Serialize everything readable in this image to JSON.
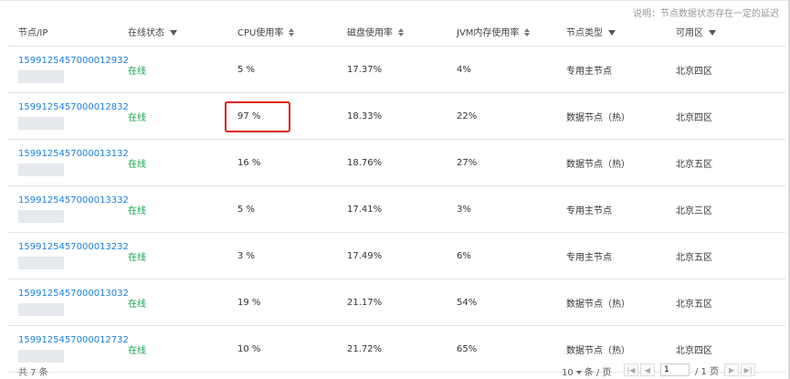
{
  "note": "说明：节点数据状态存在一定的延迟",
  "columns": {
    "node": "节点/IP",
    "status": "在线状态",
    "cpu": "CPU使用率",
    "disk": "磁盘使用率",
    "jvm": "JVM内存使用率",
    "type": "节点类型",
    "zone": "可用区"
  },
  "rows": [
    {
      "node": "1599125457000012932",
      "status": "在线",
      "cpu": "5 %",
      "disk": "17.37%",
      "jvm": "4%",
      "type": "专用主节点",
      "zone": "北京四区"
    },
    {
      "node": "1599125457000012832",
      "status": "在线",
      "cpu": "97 %",
      "disk": "18.33%",
      "jvm": "22%",
      "type": "数据节点（热）",
      "zone": "北京四区"
    },
    {
      "node": "1599125457000013132",
      "status": "在线",
      "cpu": "16 %",
      "disk": "18.76%",
      "jvm": "27%",
      "type": "数据节点（热）",
      "zone": "北京五区"
    },
    {
      "node": "1599125457000013332",
      "status": "在线",
      "cpu": "5 %",
      "disk": "17.41%",
      "jvm": "3%",
      "type": "专用主节点",
      "zone": "北京三区"
    },
    {
      "node": "1599125457000013232",
      "status": "在线",
      "cpu": "3 %",
      "disk": "17.49%",
      "jvm": "6%",
      "type": "专用主节点",
      "zone": "北京五区"
    },
    {
      "node": "1599125457000013032",
      "status": "在线",
      "cpu": "19 %",
      "disk": "21.17%",
      "jvm": "54%",
      "type": "数据节点（热）",
      "zone": "北京五区"
    },
    {
      "node": "1599125457000012732",
      "status": "在线",
      "cpu": "10 %",
      "disk": "21.72%",
      "jvm": "65%",
      "type": "数据节点（热）",
      "zone": "北京四区"
    }
  ],
  "footer": {
    "total": "共 7 条",
    "page_size": "10",
    "page_size_unit": "条 / 页",
    "current_page": "1",
    "total_pages": "/ 1 页"
  },
  "colors": {
    "link": "#1b7fe0",
    "online": "#14a54c",
    "highlight": "#e21a1a"
  }
}
